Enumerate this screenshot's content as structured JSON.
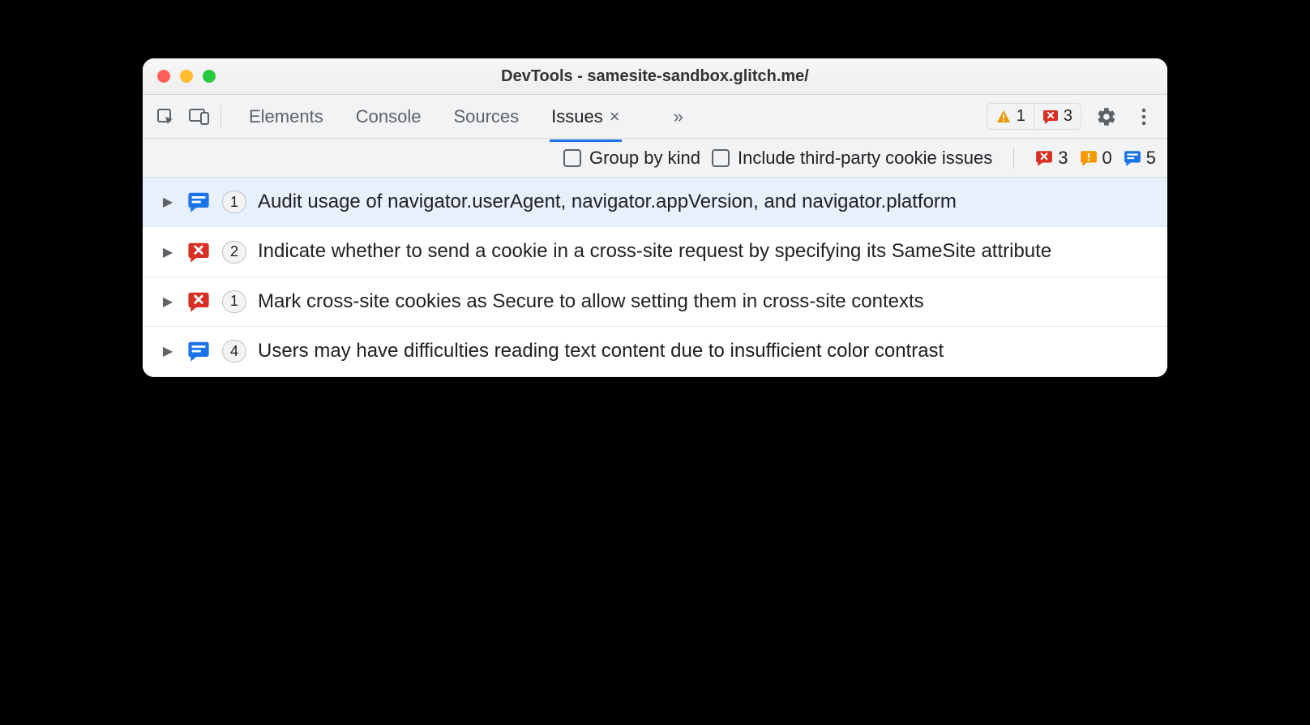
{
  "window": {
    "title": "DevTools - samesite-sandbox.glitch.me/"
  },
  "tabs": {
    "items": [
      "Elements",
      "Console",
      "Sources",
      "Issues"
    ],
    "active": "Issues",
    "overflow": "»"
  },
  "toolbar_badges": {
    "warning_count": "1",
    "error_count": "3"
  },
  "filters": {
    "group_by_kind": "Group by kind",
    "include_third_party": "Include third-party cookie issues"
  },
  "summary": {
    "errors": "3",
    "warnings": "0",
    "info": "5"
  },
  "issues": [
    {
      "kind": "info",
      "count": "1",
      "text": "Audit usage of navigator.userAgent, navigator.appVersion, and navigator.platform",
      "selected": true
    },
    {
      "kind": "error",
      "count": "2",
      "text": "Indicate whether to send a cookie in a cross-site request by specifying its SameSite attribute",
      "selected": false
    },
    {
      "kind": "error",
      "count": "1",
      "text": "Mark cross-site cookies as Secure to allow setting them in cross-site contexts",
      "selected": false
    },
    {
      "kind": "info",
      "count": "4",
      "text": "Users may have difficulties reading text content due to insufficient color contrast",
      "selected": false
    }
  ]
}
